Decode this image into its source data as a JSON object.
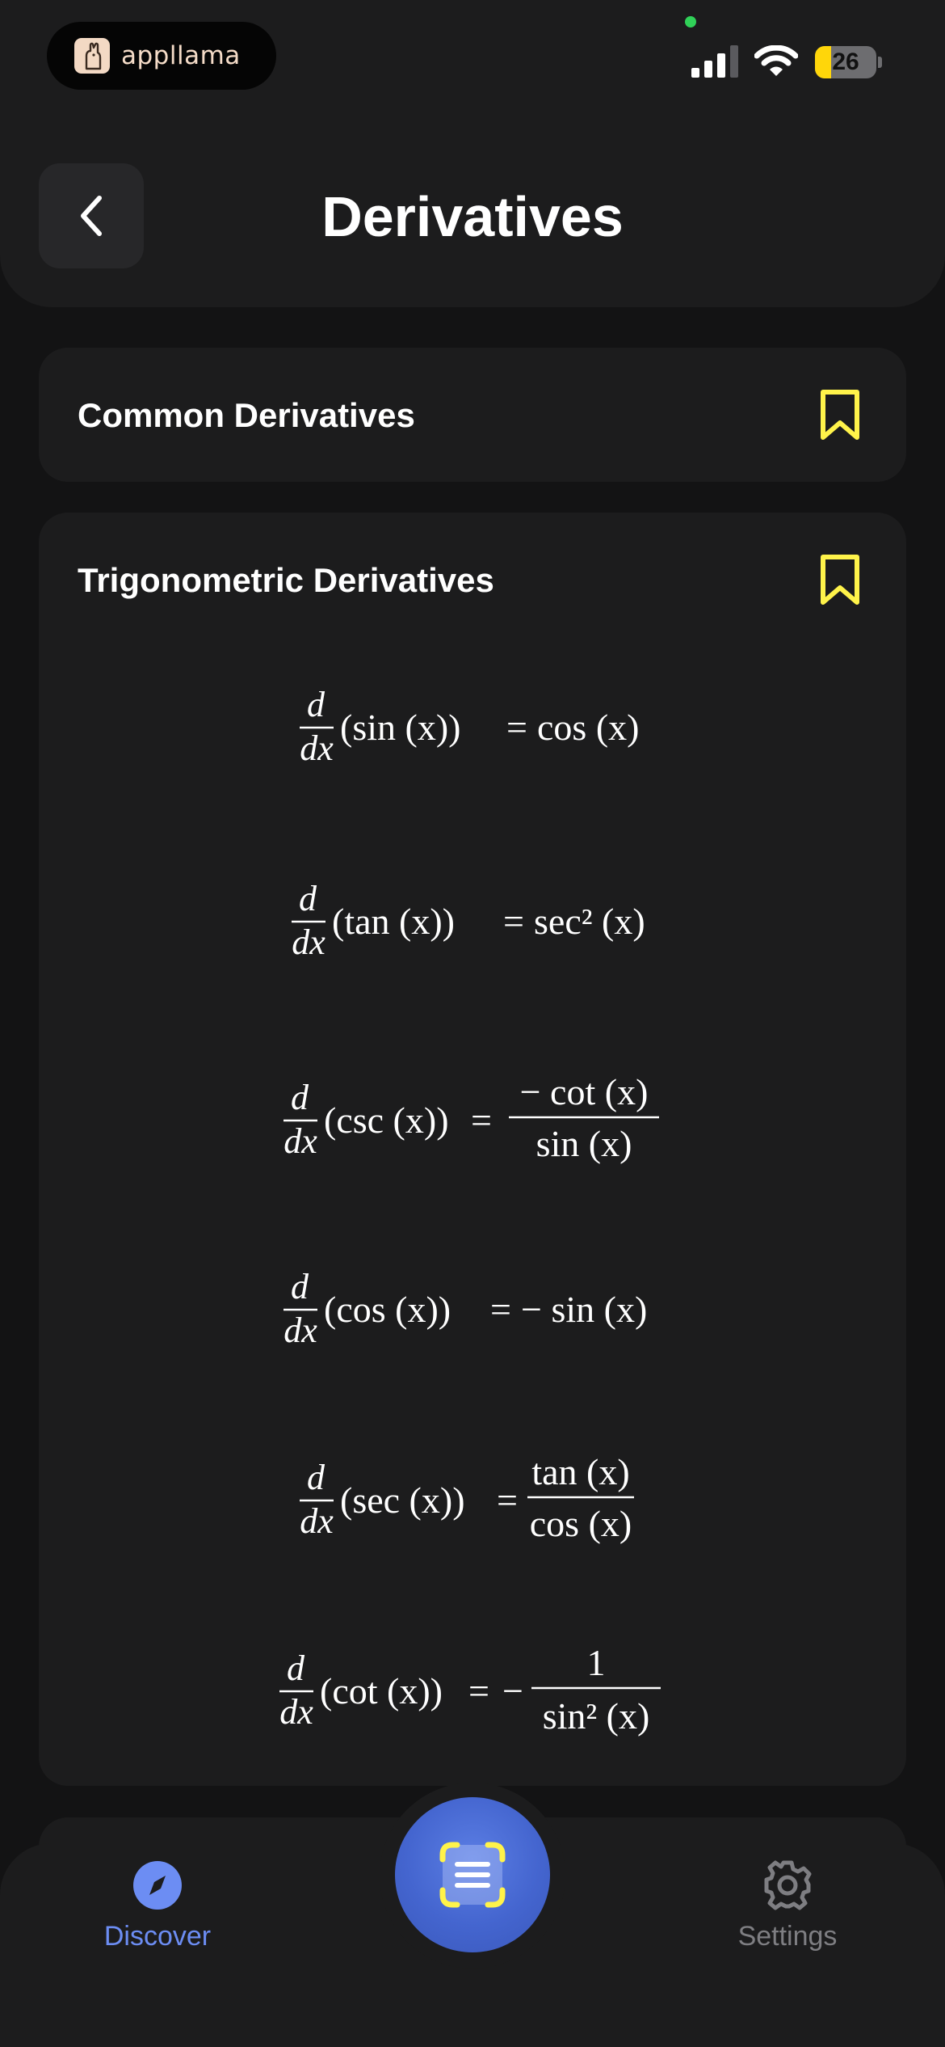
{
  "status_bar": {
    "app_name": "appllama",
    "battery_percent": 26,
    "battery_text": "26",
    "signal_bars_active": 3,
    "wifi_icon": "wifi-icon",
    "recording_indicator_color": "#30d158"
  },
  "header": {
    "title": "Derivatives",
    "back_icon": "chevron-left-icon"
  },
  "sections": [
    {
      "title": "Common Derivatives",
      "bookmark_icon": "bookmark-icon",
      "expanded": false
    },
    {
      "title": "Trigonometric Derivatives",
      "bookmark_icon": "bookmark-icon",
      "expanded": true,
      "formulas": [
        {
          "function": "sin",
          "lhs": "(sin (x))",
          "rhs": "cos (x)"
        },
        {
          "function": "tan",
          "lhs": "(tan (x))",
          "rhs": "sec² (x)"
        },
        {
          "function": "csc",
          "lhs": "(csc (x))",
          "rhs_numerator": "− cot (x)",
          "rhs_denominator": "sin (x)"
        },
        {
          "function": "cos",
          "lhs": "(cos (x))",
          "rhs": "− sin (x)"
        },
        {
          "function": "sec",
          "lhs": "(sec (x))",
          "rhs_numerator": "tan (x)",
          "rhs_denominator": "cos (x)"
        },
        {
          "function": "cot",
          "lhs": "(cot (x))",
          "rhs_prefix": "−",
          "rhs_numerator": "1",
          "rhs_denominator": "sin² (x)"
        }
      ]
    }
  ],
  "formula_parts": {
    "d": "d",
    "dx": "dx",
    "equals": "=",
    "sup2": "2",
    "x": "(x)"
  },
  "tab_bar": {
    "discover_label": "Discover",
    "settings_label": "Settings",
    "discover_icon": "compass-icon",
    "settings_icon": "gear-icon",
    "scan_icon": "scan-icon",
    "active_tab": "Discover"
  },
  "colors": {
    "accent": "#6c8df3",
    "bookmark": "#fff34a",
    "background": "#131314",
    "card": "#1c1c1d"
  }
}
